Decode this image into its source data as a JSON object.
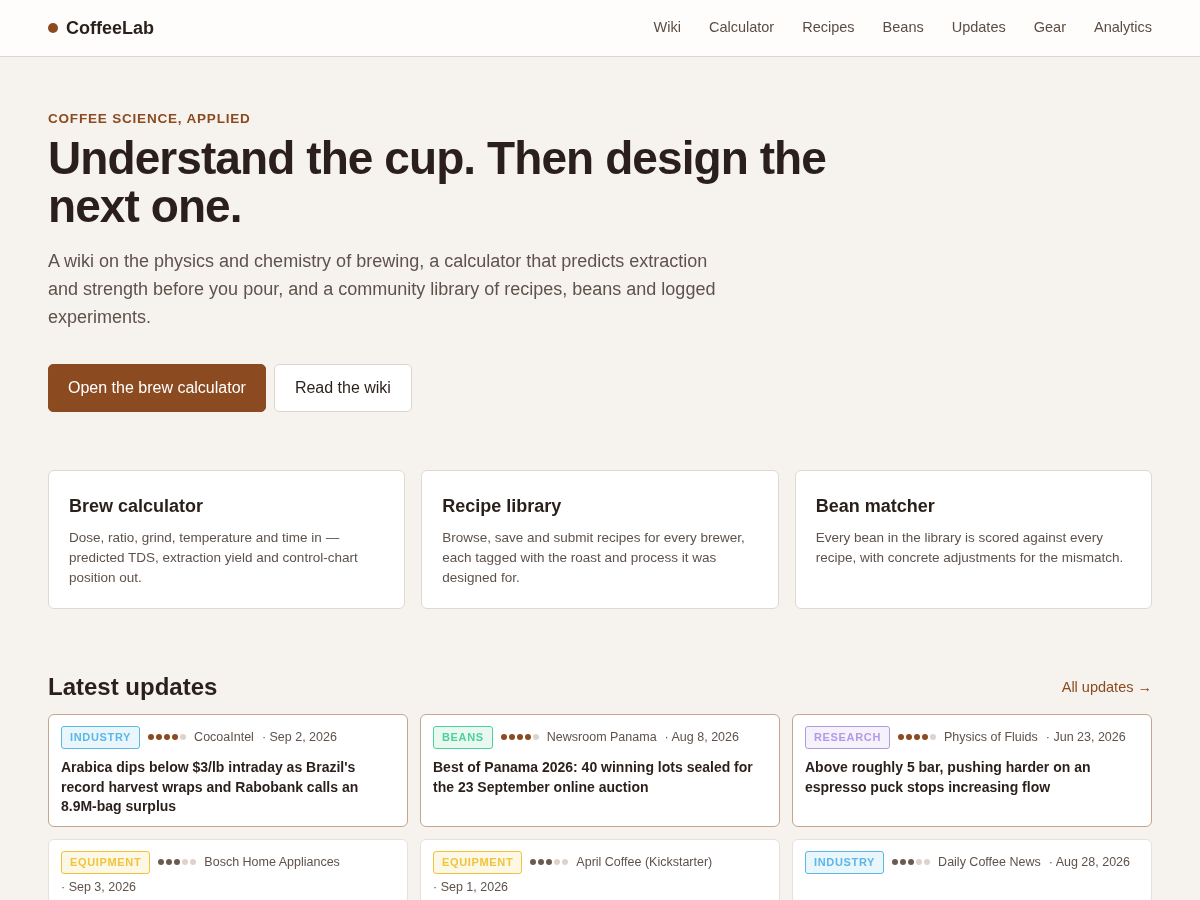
{
  "brand": {
    "name": "CoffeeLab"
  },
  "nav": [
    {
      "label": "Wiki"
    },
    {
      "label": "Calculator"
    },
    {
      "label": "Recipes"
    },
    {
      "label": "Beans"
    },
    {
      "label": "Updates"
    },
    {
      "label": "Gear"
    },
    {
      "label": "Analytics"
    }
  ],
  "hero": {
    "eyebrow": "COFFEE SCIENCE, APPLIED",
    "title": "Understand the cup. Then design the next one.",
    "lead": "A wiki on the physics and chemistry of brewing, a calculator that predicts extraction and strength before you pour, and a community library of recipes, beans and logged experiments.",
    "buttons": [
      {
        "label": "Open the brew calculator",
        "kind": "primary"
      },
      {
        "label": "Read the wiki",
        "kind": "secondary"
      }
    ]
  },
  "features": [
    {
      "title": "Brew calculator",
      "text": "Dose, ratio, grind, temperature and time in — predicted TDS, extraction yield and control-chart position out."
    },
    {
      "title": "Recipe library",
      "text": "Browse, save and submit recipes for every brewer, each tagged with the roast and process it was designed for."
    },
    {
      "title": "Bean matcher",
      "text": "Every bean in the library is scored against every recipe, with concrete adjustments for the mismatch."
    }
  ],
  "updates": {
    "title": "Latest updates",
    "link": "All updates →",
    "items": [
      {
        "tag": "INDUSTRY",
        "color": "#5bb8e6",
        "stars": 4,
        "featured": true,
        "source": "CocoaIntel",
        "date": "· Sep 2, 2026",
        "headline": "Arabica dips below $3/lb intraday as Brazil's record harvest wraps and Rabobank calls an 8.9M-bag surplus"
      },
      {
        "tag": "BEANS",
        "color": "#4fcf9a",
        "stars": 4,
        "featured": true,
        "source": "Newsroom Panama",
        "date": "· Aug 8, 2026",
        "headline": "Best of Panama 2026: 40 winning lots sealed for the 23 September online auction"
      },
      {
        "tag": "RESEARCH",
        "color": "#b49ae6",
        "stars": 4,
        "featured": true,
        "source": "Physics of Fluids",
        "date": "· Jun 23, 2026",
        "headline": "Above roughly 5 bar, pushing harder on an espresso puck stops increasing flow"
      },
      {
        "tag": "EQUIPMENT",
        "color": "#f0c43c",
        "stars": 3,
        "featured": false,
        "source": "Bosch Home Appliances",
        "date": "· Sep 3, 2026"
      },
      {
        "tag": "EQUIPMENT",
        "color": "#f0c43c",
        "stars": 3,
        "featured": false,
        "source": "April Coffee (Kickstarter)",
        "date": "· Sep 1, 2026"
      },
      {
        "tag": "INDUSTRY",
        "color": "#5bb8e6",
        "stars": 3,
        "featured": false,
        "source": "Daily Coffee News",
        "date": "· Aug 28, 2026"
      }
    ]
  }
}
